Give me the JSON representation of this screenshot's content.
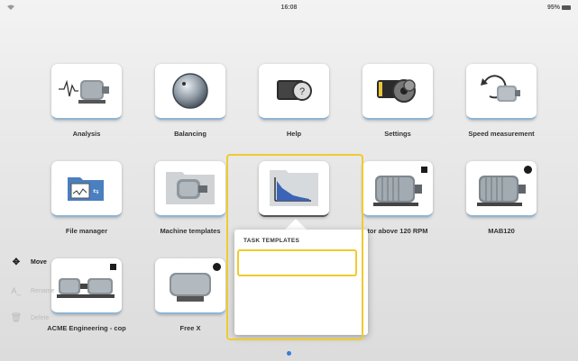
{
  "status": {
    "time": "16:08",
    "battery": "95%"
  },
  "tiles": [
    {
      "label": "Analysis",
      "icon": "analysis-icon"
    },
    {
      "label": "Balancing",
      "icon": "balancing-icon"
    },
    {
      "label": "Help",
      "icon": "help-icon"
    },
    {
      "label": "Settings",
      "icon": "settings-icon"
    },
    {
      "label": "Speed measurement",
      "icon": "speed-measurement-icon"
    },
    {
      "label": "File manager",
      "icon": "file-manager-icon"
    },
    {
      "label": "Machine templates",
      "icon": "machine-templates-icon"
    },
    {
      "label": "",
      "icon": "task-templates-folder-icon"
    },
    {
      "label": "tor above 120 RPM",
      "icon": "motor-icon"
    },
    {
      "label": "MAB120",
      "icon": "motor-icon"
    },
    {
      "label": "ACME Engineering - cop",
      "icon": "machine-train-icon"
    },
    {
      "label": "Free X",
      "icon": "motor-small-icon"
    }
  ],
  "popup": {
    "title": "TASK TEMPLATES",
    "items": [
      {
        "label": "Move",
        "icon": "move-icon",
        "enabled": true
      },
      {
        "label": "Rename",
        "icon": "rename-icon",
        "enabled": false
      },
      {
        "label": "Delete",
        "icon": "delete-icon",
        "enabled": false
      }
    ]
  },
  "colors": {
    "highlight": "#f0cb2e",
    "accent": "#3a7bd5"
  }
}
